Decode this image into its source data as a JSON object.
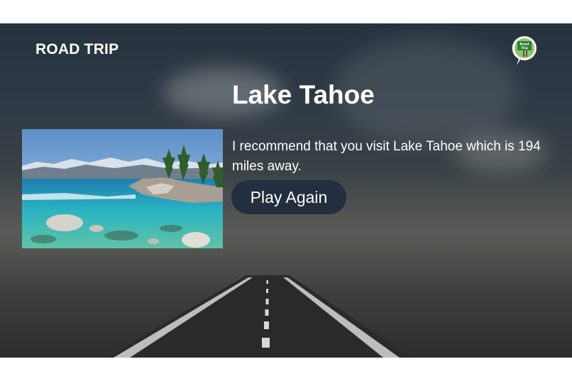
{
  "header": {
    "title": "ROAD TRIP",
    "skill_icon": "road-trip-skill-icon",
    "skill_icon_text": "Road Trip"
  },
  "main": {
    "title": "Lake Tahoe",
    "image": "lake-tahoe-photo",
    "description": "I recommend that you visit Lake Tahoe which is 194 miles away.",
    "play_again_label": "Play Again"
  },
  "colors": {
    "button_bg": "#232f3e",
    "text": "#ffffff",
    "page_bg": "#ffffff"
  }
}
